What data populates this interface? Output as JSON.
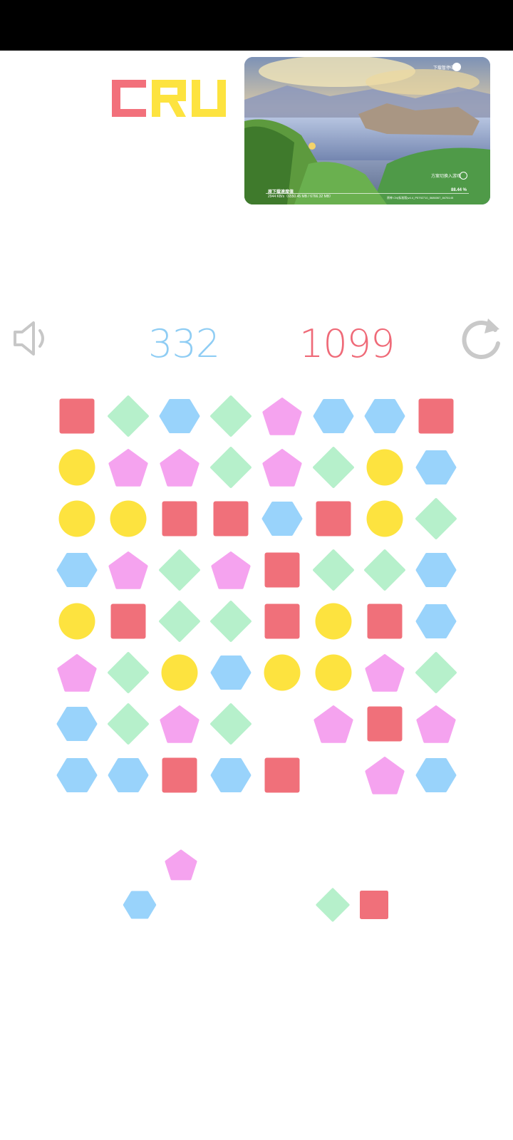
{
  "popup": {
    "top_right_label": "下载暂停中",
    "bottom_right_label": "方案切换入游戏",
    "caption_left": "原下载速度值",
    "caption_left_sub": "2944 KB/s（6550.45 MB / 6766.32 MB）",
    "caption_right": "88.44 %",
    "caption_right_sub": "原神 CN(标准版)v4.4_P5792710_5686067_8476145"
  },
  "hud": {
    "sound_icon": "speaker-icon",
    "restart_icon": "restart-icon",
    "score_blue": "332",
    "score_red": "1099"
  },
  "colors": {
    "square": "#f0707a",
    "diamond": "#b6f0cb",
    "hexagon": "#99d3fb",
    "pentagon": "#f5a3ef",
    "circle": "#fde33f",
    "logo_C": "#f2707b",
    "logo_R": "#fde33f",
    "logo_U": "#fde33f"
  },
  "board": {
    "rows": [
      [
        "square",
        "diamond",
        "hexagon",
        "diamond",
        "pentagon",
        "hexagon",
        "hexagon",
        "square"
      ],
      [
        "circle",
        "pentagon",
        "pentagon",
        "diamond",
        "pentagon",
        "diamond",
        "circle",
        "hexagon"
      ],
      [
        "circle",
        "circle",
        "square",
        "square",
        "hexagon",
        "square",
        "circle",
        "diamond"
      ],
      [
        "hexagon",
        "pentagon",
        "diamond",
        "pentagon",
        "square",
        "diamond",
        "diamond",
        "hexagon"
      ],
      [
        "circle",
        "square",
        "diamond",
        "diamond",
        "square",
        "circle",
        "square",
        "hexagon"
      ],
      [
        "pentagon",
        "diamond",
        "circle",
        "hexagon",
        "circle",
        "circle",
        "pentagon",
        "diamond"
      ],
      [
        "hexagon",
        "diamond",
        "pentagon",
        "diamond",
        "",
        "pentagon",
        "square",
        "pentagon"
      ],
      [
        "hexagon",
        "hexagon",
        "square",
        "hexagon",
        "square",
        "",
        "pentagon",
        "hexagon"
      ]
    ]
  },
  "tray": {
    "piece_1": [
      "pentagon",
      "hexagon"
    ],
    "piece_2": [
      "diamond",
      "square"
    ]
  }
}
